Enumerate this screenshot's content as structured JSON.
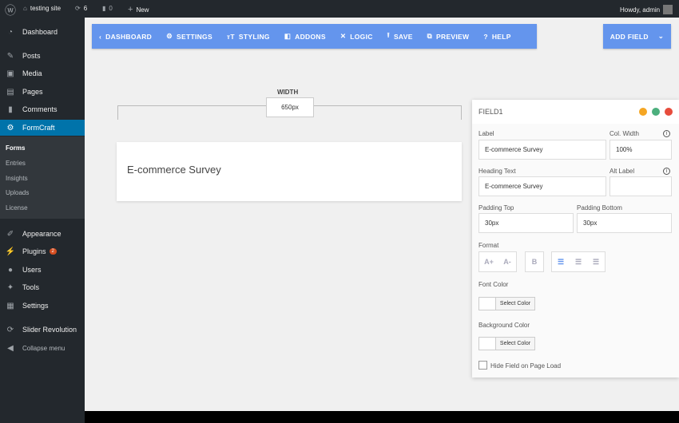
{
  "adminbar": {
    "site": "testing site",
    "updates": "6",
    "comments": "0",
    "new": "New",
    "howdy": "Howdy, admin"
  },
  "sidebar": {
    "items": [
      {
        "label": "Dashboard",
        "icon": "dashboard-icon"
      },
      {
        "label": "Posts",
        "icon": "pin-icon"
      },
      {
        "label": "Media",
        "icon": "media-icon"
      },
      {
        "label": "Pages",
        "icon": "pages-icon"
      },
      {
        "label": "Comments",
        "icon": "comment-icon"
      },
      {
        "label": "FormCraft",
        "icon": "gear-icon"
      },
      {
        "label": "Appearance",
        "icon": "brush-icon"
      },
      {
        "label": "Plugins",
        "icon": "plug-icon",
        "badge": "2"
      },
      {
        "label": "Users",
        "icon": "user-icon"
      },
      {
        "label": "Tools",
        "icon": "wrench-icon"
      },
      {
        "label": "Settings",
        "icon": "settings-icon"
      },
      {
        "label": "Slider Revolution",
        "icon": "refresh-icon"
      },
      {
        "label": "Collapse menu",
        "icon": "collapse-icon"
      }
    ],
    "submenu": [
      "Forms",
      "Entries",
      "Insights",
      "Uploads",
      "License"
    ]
  },
  "toolbar": {
    "items": [
      "DASHBOARD",
      "SETTINGS",
      "STYLING",
      "ADDONS",
      "LOGIC",
      "SAVE",
      "PREVIEW",
      "HELP"
    ],
    "add_field": "ADD FIELD"
  },
  "canvas": {
    "width_label": "WIDTH",
    "width_value": "650px",
    "heading": "E-commerce Survey"
  },
  "panel": {
    "title": "FIELD1",
    "label": "Label",
    "label_value": "E-commerce Survey",
    "col_width": "Col. Width",
    "col_width_value": "100%",
    "heading_text": "Heading Text",
    "heading_value": "E-commerce Survey",
    "alt_label": "Alt Label",
    "alt_label_value": "",
    "padding_top": "Padding Top",
    "padding_top_value": "30px",
    "padding_bottom": "Padding Bottom",
    "padding_bottom_value": "30px",
    "format": "Format",
    "font_plus": "A+",
    "font_minus": "A-",
    "bold": "B",
    "font_color": "Font Color",
    "bg_color": "Background Color",
    "select_color": "Select Color",
    "hide_field": "Hide Field on Page Load"
  },
  "colors": {
    "accent": "#6495ed",
    "wp_active": "#0073aa",
    "minimize": "#f5a623",
    "maximize": "#4caf7d",
    "close": "#e74c3c"
  }
}
